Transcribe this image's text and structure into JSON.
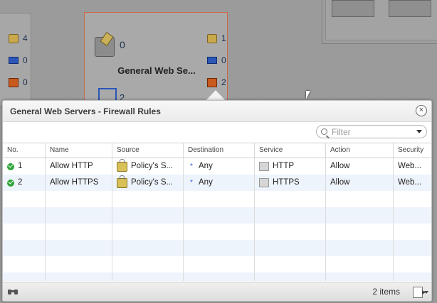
{
  "background": {
    "left_card": {
      "policy_count": "4",
      "vm_count": "0",
      "firewall_count": "0"
    },
    "center_card": {
      "title": "General Web Se...",
      "policy_count": "0",
      "right_policy_count": "1",
      "right_vm_count": "0",
      "right_firewall_count": "2",
      "group_count": "2"
    }
  },
  "popup": {
    "title": "General Web Servers - Firewall Rules",
    "close_label": "×",
    "filter_placeholder": "Filter",
    "columns": [
      "No.",
      "Name",
      "Source",
      "Destination",
      "Service",
      "Action",
      "Security"
    ],
    "rows": [
      {
        "no": "1",
        "name": "Allow HTTP",
        "source": "Policy's S...",
        "destination": "Any",
        "service": "HTTP",
        "action": "Allow",
        "security": "Web..."
      },
      {
        "no": "2",
        "name": "Allow HTTPS",
        "source": "Policy's S...",
        "destination": "Any",
        "service": "HTTPS",
        "action": "Allow",
        "security": "Web..."
      }
    ],
    "item_count": "2 items"
  },
  "colors": {
    "accent": "#2ea43a",
    "selection_border": "#c86a4a",
    "row_alt": "#eef4fb"
  },
  "icons": [
    "policy-icon",
    "vm-icon",
    "firewall-icon",
    "check-icon",
    "lock-icon",
    "any-icon",
    "service-icon",
    "binoculars-icon",
    "export-icon",
    "search-icon",
    "close-icon"
  ]
}
